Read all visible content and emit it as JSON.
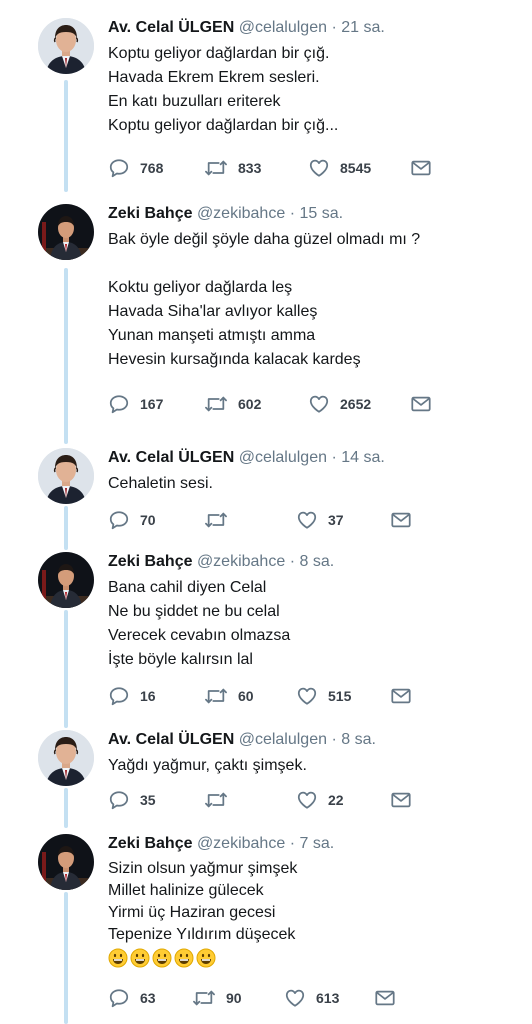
{
  "tweets": [
    {
      "author": "av-celal-ulgen",
      "name": "Av. Celal ÜLGEN",
      "handle": "@celalulgen",
      "dot": "·",
      "time": "21 sa.",
      "lines": [
        "Koptu geliyor dağlardan bir çığ.",
        "Havada Ekrem Ekrem sesleri.",
        "En katı buzulları eriterek",
        "Koptu geliyor dağlardan bir çığ..."
      ],
      "replies": "768",
      "retweets": "833",
      "likes": "8545"
    },
    {
      "author": "zeki-bahce",
      "name": "Zeki Bahçe",
      "handle": "@zekibahce",
      "dot": "·",
      "time": "15 sa.",
      "lines": [
        "Bak öyle değil şöyle daha güzel olmadı mı ?",
        "",
        "Koktu geliyor dağlarda leş",
        "Havada Siha'lar avlıyor kalleş",
        "Yunan manşeti atmıştı amma",
        "Hevesin kursağında kalacak kardeş"
      ],
      "replies": "167",
      "retweets": "602",
      "likes": "2652"
    },
    {
      "author": "av-celal-ulgen",
      "name": "Av. Celal ÜLGEN",
      "handle": "@celalulgen",
      "dot": "·",
      "time": "14 sa.",
      "lines": [
        "Cehaletin sesi."
      ],
      "replies": "70",
      "retweets": "",
      "likes": "37"
    },
    {
      "author": "zeki-bahce",
      "name": "Zeki Bahçe",
      "handle": "@zekibahce",
      "dot": "·",
      "time": "8 sa.",
      "lines": [
        "Bana cahil diyen Celal",
        "Ne bu şiddet ne bu celal",
        "Verecek cevabın olmazsa",
        "İşte böyle kalırsın lal"
      ],
      "replies": "16",
      "retweets": "60",
      "likes": "515"
    },
    {
      "author": "av-celal-ulgen",
      "name": "Av. Celal ÜLGEN",
      "handle": "@celalulgen",
      "dot": "·",
      "time": "8 sa.",
      "lines": [
        "Yağdı yağmur, çaktı şimşek."
      ],
      "replies": "35",
      "retweets": "",
      "likes": "22"
    },
    {
      "author": "zeki-bahce",
      "name": "Zeki Bahçe",
      "handle": "@zekibahce",
      "dot": "·",
      "time": "7 sa.",
      "lines": [
        "Sizin olsun yağmur şimşek",
        "Millet halinize gülecek",
        "Yirmi üç Haziran gecesi",
        "Tepenize Yıldırım düşecek"
      ],
      "emoji": [
        "😀",
        "😀",
        "😀",
        "😀",
        "😀"
      ],
      "replies": "63",
      "retweets": "90",
      "likes": "613"
    }
  ],
  "colors": {
    "thread_line": "#c4e0f2",
    "icon": "#657786",
    "text": "#14171a",
    "muted": "#657786"
  },
  "icons": {
    "reply": "reply-icon",
    "retweet": "retweet-icon",
    "like": "heart-icon",
    "dm": "envelope-icon",
    "emoji": "grinning-face-icon"
  }
}
